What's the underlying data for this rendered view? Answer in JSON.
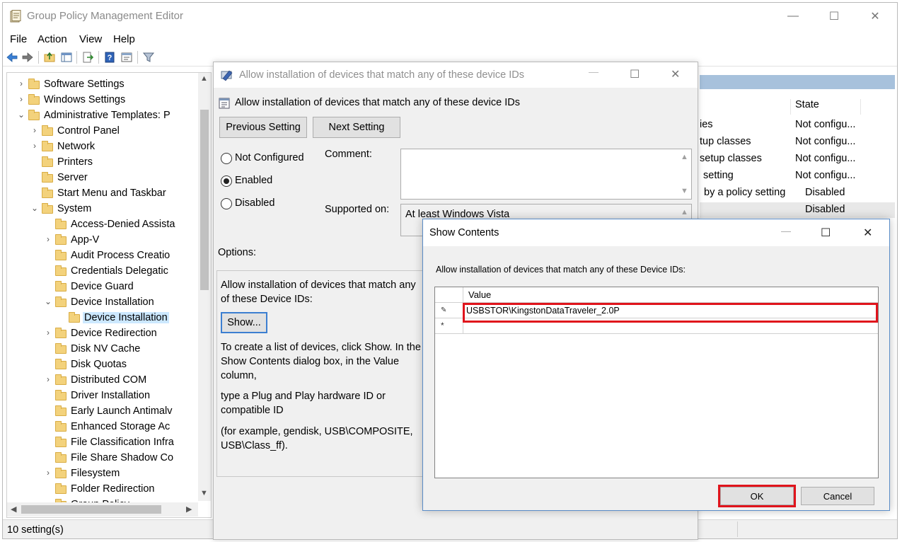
{
  "main": {
    "title": "Group Policy Management Editor",
    "window_controls": {
      "minimize": "—",
      "maximize": "☐",
      "close": "✕"
    },
    "menu": [
      "File",
      "Action",
      "View",
      "Help"
    ],
    "tree": [
      {
        "label": "Software Settings",
        "chev": "›"
      },
      {
        "label": "Windows Settings",
        "chev": "›"
      },
      {
        "label": "Administrative Templates: P",
        "chev": "⌄"
      },
      {
        "label": "Control Panel",
        "chev": "›"
      },
      {
        "label": "Network",
        "chev": "›"
      },
      {
        "label": "Printers",
        "chev": ""
      },
      {
        "label": "Server",
        "chev": ""
      },
      {
        "label": "Start Menu and Taskbar",
        "chev": ""
      },
      {
        "label": "System",
        "chev": "⌄"
      },
      {
        "label": "Access-Denied Assista",
        "chev": ""
      },
      {
        "label": "App-V",
        "chev": "›"
      },
      {
        "label": "Audit Process Creatio",
        "chev": ""
      },
      {
        "label": "Credentials Delegatic",
        "chev": ""
      },
      {
        "label": "Device Guard",
        "chev": ""
      },
      {
        "label": "Device Installation",
        "chev": "⌄"
      },
      {
        "label": "Device Installation",
        "chev": ""
      },
      {
        "label": "Device Redirection",
        "chev": "›"
      },
      {
        "label": "Disk NV Cache",
        "chev": ""
      },
      {
        "label": "Disk Quotas",
        "chev": ""
      },
      {
        "label": "Distributed COM",
        "chev": "›"
      },
      {
        "label": "Driver Installation",
        "chev": ""
      },
      {
        "label": "Early Launch Antimalv",
        "chev": ""
      },
      {
        "label": "Enhanced Storage Ac",
        "chev": ""
      },
      {
        "label": "File Classification Infra",
        "chev": ""
      },
      {
        "label": "File Share Shadow Co",
        "chev": ""
      },
      {
        "label": "Filesystem",
        "chev": "›"
      },
      {
        "label": "Folder Redirection",
        "chev": ""
      },
      {
        "label": "Group Policy",
        "chev": ""
      }
    ],
    "right_list": {
      "state_header": "State",
      "rows": [
        {
          "setting": "ies",
          "state": "Not configu..."
        },
        {
          "setting": "tup classes",
          "state": "Not configu..."
        },
        {
          "setting": "setup classes",
          "state": "Not configu..."
        },
        {
          "setting": "setting",
          "state": "Not configu..."
        },
        {
          "setting": "by a policy setting",
          "state": "Disabled"
        },
        {
          "setting": "",
          "state": "Disabled"
        }
      ]
    },
    "status": "10 setting(s)"
  },
  "policy_dialog": {
    "title": "Allow installation of devices that match any of these device IDs",
    "heading": "Allow installation of devices that match any of these device IDs",
    "prev_label": "Previous Setting",
    "next_label": "Next Setting",
    "radios": [
      "Not Configured",
      "Enabled",
      "Disabled"
    ],
    "selected_radio": "Enabled",
    "comment_label": "Comment:",
    "supported_label": "Supported on:",
    "supported_value": "At least Windows Vista",
    "options_label": "Options:",
    "options_text": "Allow installation of devices that match any of these Device IDs:",
    "show_label": "Show...",
    "help_p1": "To create a list of devices, click Show. In the Show Contents dialog box, in the Value column,",
    "help_p2": "type a Plug and Play hardware ID or compatible ID",
    "help_p3": "(for example, gendisk, USB\\COMPOSITE, USB\\Class_ff)."
  },
  "show_dialog": {
    "title": "Show Contents",
    "prompt": "Allow installation of devices that match any of these Device IDs:",
    "column_header": "Value",
    "rows": [
      {
        "marker": "✎",
        "value": "USBSTOR\\KingstonDataTraveler_2.0P"
      },
      {
        "marker": "*",
        "value": ""
      }
    ],
    "ok_label": "OK",
    "cancel_label": "Cancel"
  },
  "accent": {
    "highlight": "#e0141c",
    "selection": "#cce8ff"
  }
}
